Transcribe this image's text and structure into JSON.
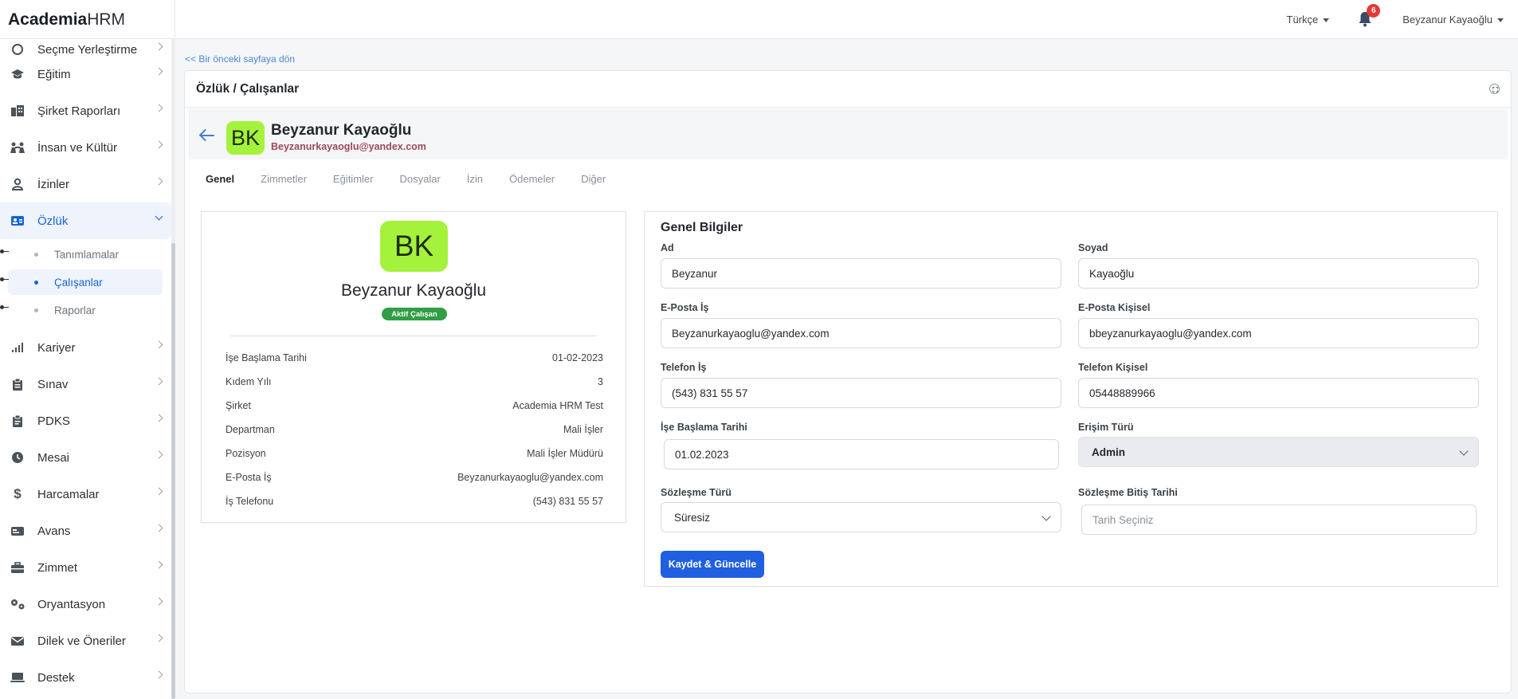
{
  "brand": {
    "bold": "Academia",
    "light": "HRM"
  },
  "topbar": {
    "language": "Türkçe",
    "notifications": "6",
    "user": "Beyzanur Kayaoğlu"
  },
  "sidebar": {
    "partial_item": "Seçme Yerleştirme",
    "items": [
      {
        "label": "Eğitim",
        "icon": "graduation-cap-icon"
      },
      {
        "label": "Şirket Raporları",
        "icon": "buildings-icon"
      },
      {
        "label": "İnsan ve Kültür",
        "icon": "people-icon"
      },
      {
        "label": "İzinler",
        "icon": "user-icon"
      },
      {
        "label": "Özlük",
        "icon": "id-card-icon"
      },
      {
        "label": "Kariyer",
        "icon": "signal-bars-icon"
      },
      {
        "label": "Sınav",
        "icon": "clipboard-icon"
      },
      {
        "label": "PDKS",
        "icon": "clipboard-check-icon"
      },
      {
        "label": "Mesai",
        "icon": "clock-icon"
      },
      {
        "label": "Harcamalar",
        "icon": "dollar-icon"
      },
      {
        "label": "Avans",
        "icon": "money-card-icon"
      },
      {
        "label": "Zimmet",
        "icon": "toolbox-icon"
      },
      {
        "label": "Oryantasyon",
        "icon": "gears-icon"
      },
      {
        "label": "Dilek ve Öneriler",
        "icon": "envelope-icon"
      },
      {
        "label": "Destek",
        "icon": "laptop-icon"
      }
    ],
    "subitems": [
      "Tanımlamalar",
      "Çalışanlar",
      "Raporlar"
    ]
  },
  "page": {
    "back_link": "<< Bir önceki sayfaya dön",
    "title": "Özlük / Çalışanlar"
  },
  "profile": {
    "initials": "BK",
    "name": "Beyzanur Kayaoğlu",
    "email": "Beyzanurkayaoglu@yandex.com",
    "status": "Aktif Çalışan"
  },
  "tabs": [
    "Genel",
    "Zimmetler",
    "Eğitimler",
    "Dosyalar",
    "İzin",
    "Ödemeler",
    "Diğer"
  ],
  "details": [
    {
      "label": "İşe Başlama Tarihi",
      "value": "01-02-2023"
    },
    {
      "label": "Kıdem Yılı",
      "value": "3"
    },
    {
      "label": "Şirket",
      "value": "Academia HRM Test"
    },
    {
      "label": "Departman",
      "value": "Mali İşler"
    },
    {
      "label": "Pozisyon",
      "value": "Mali İşler Müdürü"
    },
    {
      "label": "E-Posta İş",
      "value": "Beyzanurkayaoglu@yandex.com"
    },
    {
      "label": "İş Telefonu",
      "value": "(543) 831 55 57"
    }
  ],
  "form": {
    "title": "Genel Bilgiler",
    "ad": {
      "label": "Ad",
      "value": "Beyzanur"
    },
    "soyad": {
      "label": "Soyad",
      "value": "Kayaoğlu"
    },
    "eposta_is": {
      "label": "E-Posta İş",
      "value": "Beyzanurkayaoglu@yandex.com"
    },
    "eposta_kisisel": {
      "label": "E-Posta Kişisel",
      "value": "bbeyzanurkayaoglu@yandex.com"
    },
    "telefon_is": {
      "label": "Telefon İş",
      "value": "(543) 831 55 57"
    },
    "telefon_kisisel": {
      "label": "Telefon Kişisel",
      "value": "05448889966"
    },
    "ise_baslama": {
      "label": "İşe Başlama Tarihi",
      "value": "01.02.2023"
    },
    "erisim_turu": {
      "label": "Erişim Türü",
      "value": "Admin"
    },
    "sozlesme_turu": {
      "label": "Sözleşme Türü",
      "value": "Süresiz"
    },
    "sozlesme_bitis": {
      "label": "Sözleşme Bitiş Tarihi",
      "placeholder": "Tarih Seçiniz"
    },
    "save_label": "Kaydet & Güncelle"
  }
}
